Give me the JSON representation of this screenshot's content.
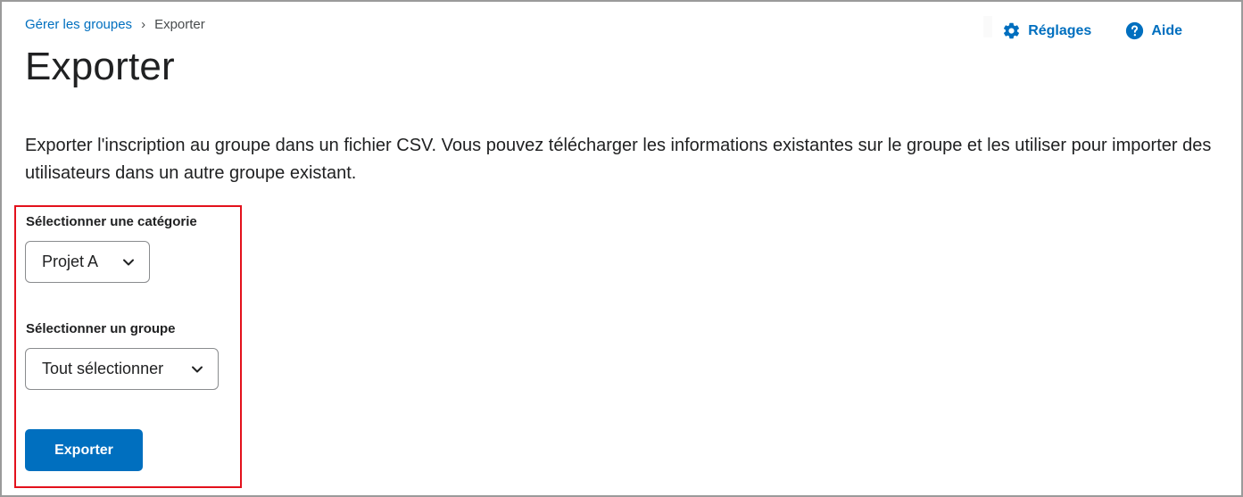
{
  "breadcrumb": {
    "parent": "Gérer les groupes",
    "separator": "›",
    "current": "Exporter"
  },
  "page_title": "Exporter",
  "actions": {
    "settings_label": "Réglages",
    "help_label": "Aide"
  },
  "description": "Exporter l'inscription au groupe dans un fichier CSV. Vous pouvez télécharger les informations existantes sur le groupe et les utiliser pour importer des utilisateurs dans un autre groupe existant.",
  "form": {
    "category_label": "Sélectionner une catégorie",
    "category_value": "Projet A",
    "group_label": "Sélectionner un groupe",
    "group_value": "Tout sélectionner",
    "export_button": "Exporter"
  },
  "icons": {
    "settings": "gear-icon",
    "help": "question-circle-icon",
    "dropdown": "chevron-down-icon"
  },
  "colors": {
    "link": "#006fbf",
    "primary_button": "#006fbf",
    "highlight_border": "#e3111c"
  }
}
